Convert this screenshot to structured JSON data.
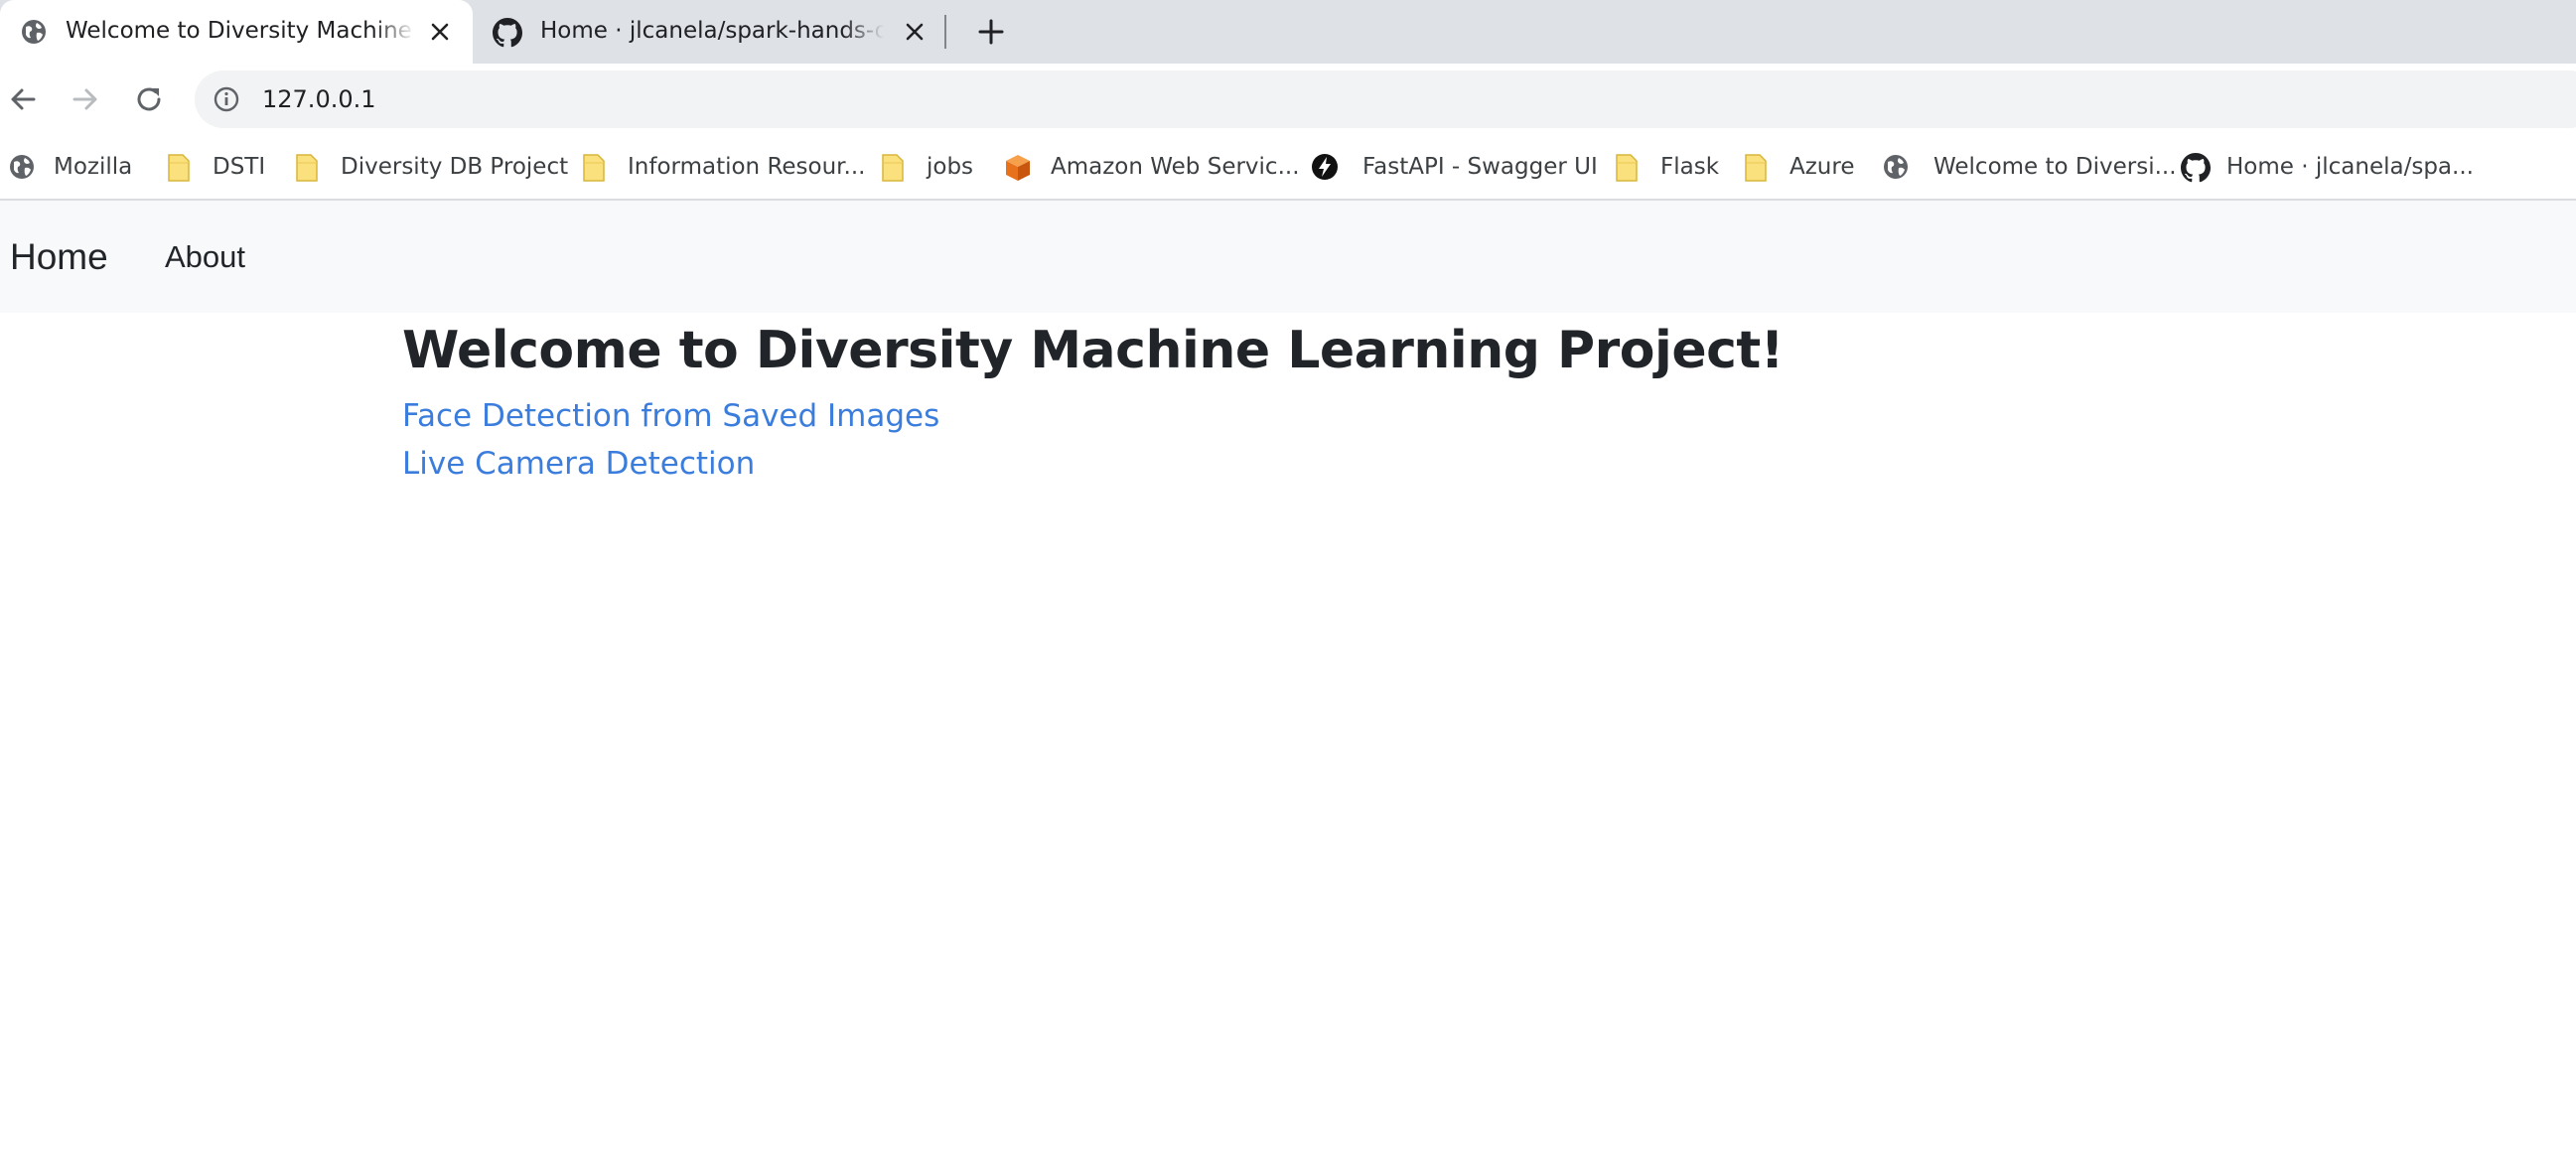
{
  "browser": {
    "tabs": [
      {
        "title": "Welcome to Diversity Machine Learning Project!",
        "favicon": "globe-icon",
        "active": true
      },
      {
        "title": "Home · jlcanela/spark-hands-on Wiki",
        "favicon": "github-icon",
        "active": false
      }
    ],
    "address": "127.0.0.1",
    "bookmarks": [
      {
        "label": "Mozilla",
        "icon": "globe-icon"
      },
      {
        "label": "DSTI",
        "icon": "folder-icon"
      },
      {
        "label": "Diversity DB Project",
        "icon": "folder-icon"
      },
      {
        "label": "Information Resour...",
        "icon": "folder-icon"
      },
      {
        "label": "jobs",
        "icon": "folder-icon"
      },
      {
        "label": "Amazon Web Servic...",
        "icon": "aws-cube-icon"
      },
      {
        "label": "FastAPI - Swagger UI",
        "icon": "lightning-icon"
      },
      {
        "label": "Flask",
        "icon": "folder-icon"
      },
      {
        "label": "Azure",
        "icon": "folder-icon"
      },
      {
        "label": "Welcome to Diversi...",
        "icon": "globe-icon"
      },
      {
        "label": "Home · jlcanela/spa...",
        "icon": "github-icon"
      }
    ]
  },
  "site": {
    "nav": {
      "brand": "Home",
      "about": "About"
    },
    "heading": "Welcome to Diversity Machine Learning Project!",
    "links": [
      "Face Detection from Saved Images",
      "Live Camera Detection"
    ]
  },
  "colors": {
    "link": "#3b7ddd",
    "navbar_bg": "#f8f9fa",
    "tabstrip_bg": "#dee1e6",
    "folder": "#fbe17d"
  }
}
